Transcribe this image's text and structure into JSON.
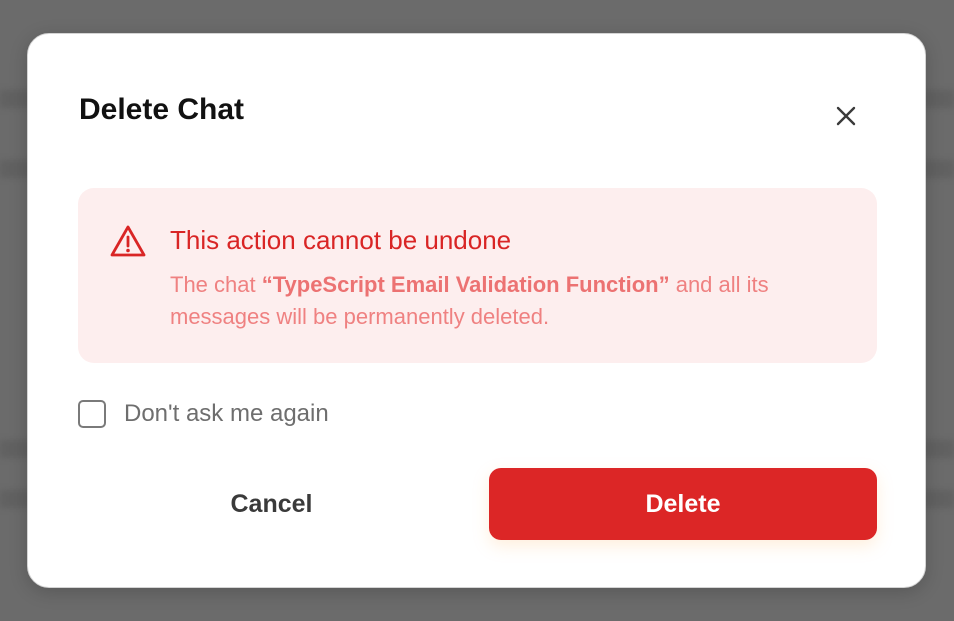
{
  "dialog": {
    "title": "Delete Chat",
    "close_icon": "close-icon",
    "warning": {
      "icon": "warning-triangle-icon",
      "title": "This action cannot be undone",
      "body_prefix": "The chat ",
      "chat_name": "“TypeScript Email Validation Function”",
      "body_suffix": " and all its messages will be permanently deleted."
    },
    "checkbox": {
      "label": "Don't ask me again",
      "checked": false
    },
    "cancel_label": "Cancel",
    "delete_label": "Delete"
  },
  "colors": {
    "danger": "#dc2626",
    "alert_background": "#fdeeee",
    "alert_text": "#ef8181"
  }
}
